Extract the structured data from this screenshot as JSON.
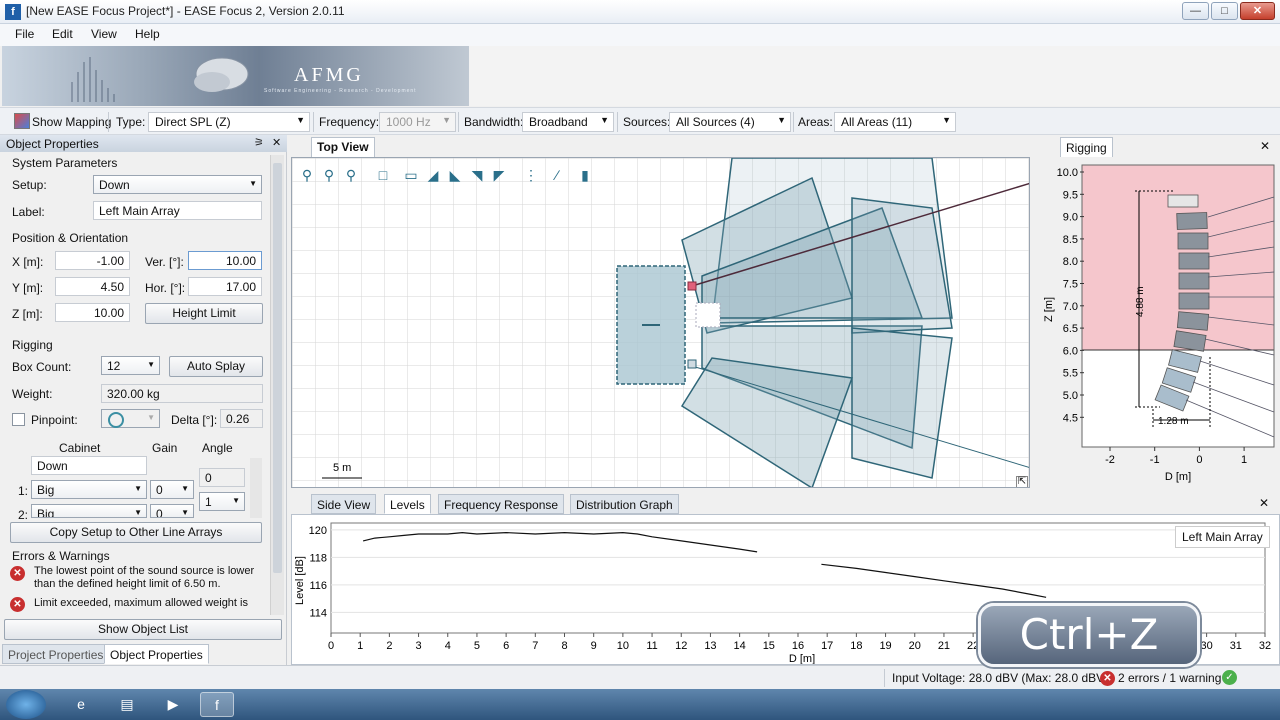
{
  "window": {
    "title": "[New EASE Focus Project*] - EASE Focus 2, Version 2.0.11",
    "icon_letter": "f",
    "controls": [
      "minimize-icon",
      "maximize-icon",
      "close-icon"
    ]
  },
  "menu": [
    "File",
    "Edit",
    "View",
    "Help"
  ],
  "banner": {
    "brand": "AFMG",
    "tagline": "Software Engineering - Research - Development"
  },
  "toolbar": {
    "show_mapping": "Show Mapping",
    "type_label": "Type:",
    "type_value": "Direct SPL (Z)",
    "frequency_label": "Frequency:",
    "frequency_value": "1000 Hz",
    "bandwidth_label": "Bandwidth:",
    "bandwidth_value": "Broadband",
    "sources_label": "Sources:",
    "sources_value": "All Sources (4)",
    "areas_label": "Areas:",
    "areas_value": "All Areas (11)"
  },
  "object_properties": {
    "header": "Object Properties",
    "system_parameters": "System Parameters",
    "setup_label": "Setup:",
    "setup_value": "Down",
    "label_label": "Label:",
    "label_value": "Left Main Array",
    "position_orientation": "Position & Orientation",
    "x_label": "X [m]:",
    "x_value": "-1.00",
    "y_label": "Y [m]:",
    "y_value": "4.50",
    "z_label": "Z [m]:",
    "z_value": "10.00",
    "ver_label": "Ver. [°]:",
    "ver_value": "10.00",
    "hor_label": "Hor. [°]:",
    "hor_value": "17.00",
    "height_limit": "Height Limit",
    "rigging": "Rigging",
    "box_count_label": "Box Count:",
    "box_count_value": "12",
    "auto_splay": "Auto Splay",
    "weight_label": "Weight:",
    "weight_value": "320.00 kg",
    "pinpoint_label": "Pinpoint:",
    "delta_label": "Delta [°]:",
    "delta_value": "0.26",
    "table_headers": [
      "Cabinet",
      "Gain",
      "Angle"
    ],
    "top_cabinet": "Down",
    "top_angle": "0",
    "rows": [
      {
        "index": "1:",
        "cabinet": "Big",
        "gain": "0",
        "angle": "1"
      },
      {
        "index": "2:",
        "cabinet": "Big",
        "gain": "0",
        "angle": ""
      }
    ],
    "copy_setup": "Copy Setup to Other Line Arrays",
    "errors_title": "Errors & Warnings",
    "errors": [
      "The lowest point of the sound source is lower than the defined height limit of 6.50 m.",
      "Limit exceeded, maximum allowed weight is"
    ],
    "show_object_list": "Show Object List",
    "tabs": [
      "Project Properties",
      "Object Properties"
    ]
  },
  "top_view": {
    "tab": "Top View",
    "scale": "5 m"
  },
  "rigging": {
    "tab": "Rigging",
    "y_axis_label": "Z [m]",
    "x_axis_label": "D [m]",
    "y_ticks": [
      "10.0",
      "9.5",
      "9.0",
      "8.5",
      "8.0",
      "7.5",
      "7.0",
      "6.5",
      "6.0",
      "5.5",
      "5.0",
      "4.5"
    ],
    "x_ticks": [
      "-2",
      "-1",
      "0",
      "1"
    ],
    "height_dim": "4.88 m",
    "width_dim": "1.28 m"
  },
  "bottom_tabs": [
    "Side View",
    "Levels",
    "Frequency Response",
    "Distribution Graph"
  ],
  "chart_data": {
    "type": "line",
    "legend": "Left Main Array",
    "ylabel": "Level [dB]",
    "xlabel": "D [m]",
    "xlim": [
      0,
      32
    ],
    "ylim": [
      112.5,
      120.5
    ],
    "yticks": [
      114,
      116,
      118,
      120
    ],
    "xticks": [
      0,
      1,
      2,
      3,
      4,
      5,
      6,
      7,
      8,
      9,
      10,
      11,
      12,
      13,
      14,
      15,
      16,
      17,
      18,
      19,
      20,
      21,
      22,
      23,
      24,
      25,
      26,
      27,
      28,
      29,
      30,
      31,
      32
    ],
    "series": [
      {
        "x": [
          1.1,
          1.5,
          2,
          2.5,
          3,
          3.5,
          4,
          4.5,
          5,
          6,
          7,
          8,
          9,
          10,
          10.5,
          11,
          12,
          13,
          14,
          14.6
        ],
        "y": [
          119.2,
          119.4,
          119.5,
          119.6,
          119.7,
          119.7,
          119.7,
          119.8,
          119.7,
          119.8,
          119.7,
          119.8,
          119.7,
          119.8,
          119.7,
          119.5,
          119.2,
          118.9,
          118.6,
          118.4
        ]
      },
      {
        "x": [
          16.8,
          18,
          19,
          20,
          21,
          22,
          23,
          24,
          24.5
        ],
        "y": [
          117.5,
          117.2,
          116.9,
          116.6,
          116.3,
          116.0,
          115.7,
          115.3,
          115.1
        ]
      }
    ]
  },
  "status": {
    "input_voltage": "Input Voltage: 28.0 dBV (Max: 28.0 dBV)",
    "errors": "2 errors / 1 warning"
  },
  "overlay": "Ctrl+Z",
  "taskbar": [
    "start-orb-icon",
    "ie-icon",
    "folder-icon",
    "media-icon",
    "ease-focus-icon"
  ]
}
